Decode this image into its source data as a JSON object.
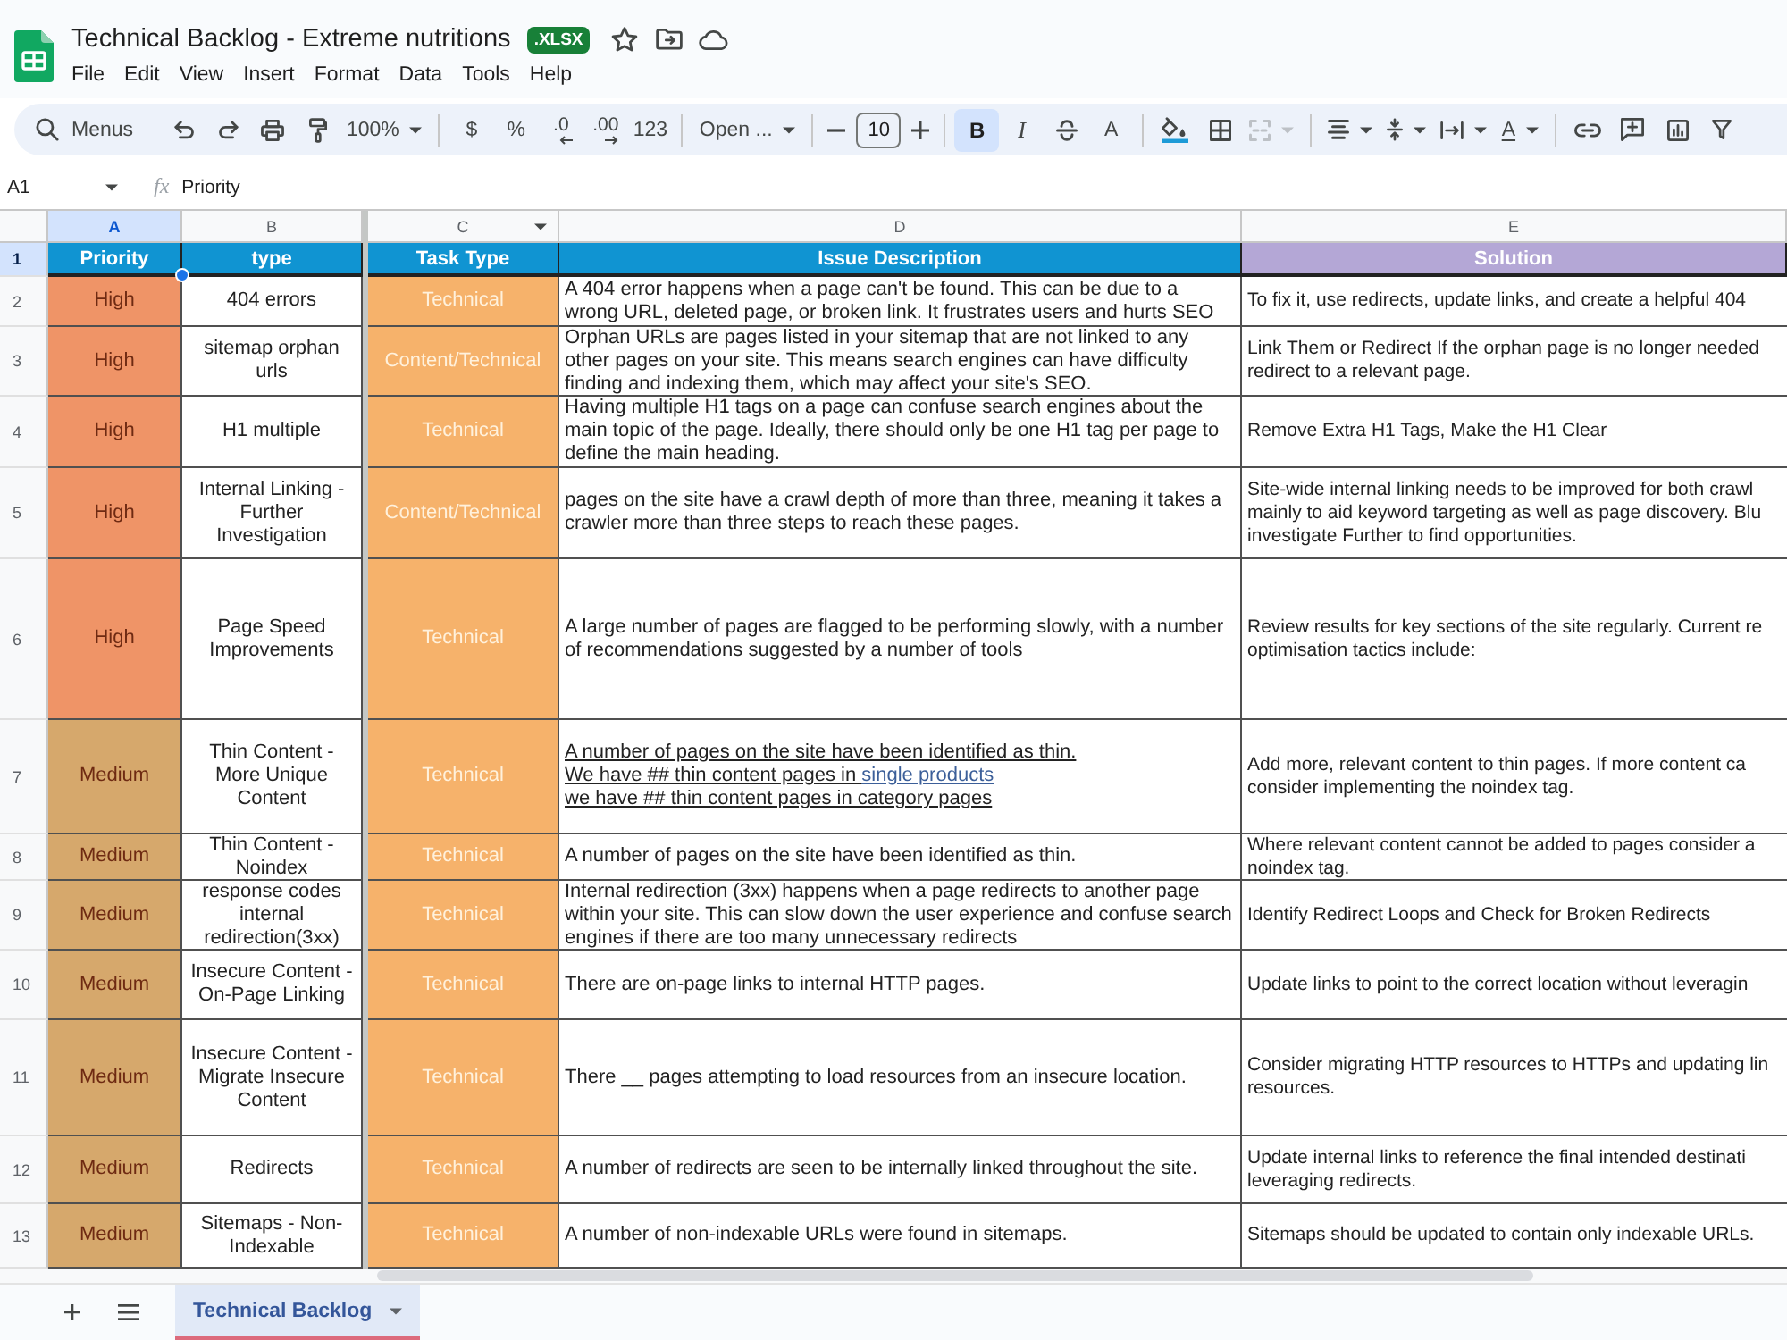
{
  "window": {
    "title": "Technical Backlog - Extreme nutritions",
    "badge": ".XLSX"
  },
  "menu": [
    "File",
    "Edit",
    "View",
    "Insert",
    "Format",
    "Data",
    "Tools",
    "Help"
  ],
  "toolbar": {
    "search": {
      "placeholder": "Menus"
    },
    "zoom": "100%",
    "currency": "$",
    "percent": "%",
    "decrease_decimals": ".0",
    "increase_decimals": ".00",
    "number_format": "123",
    "font": "Open ...",
    "font_size": "10",
    "style_buttons": [
      {
        "label": "B",
        "on": true
      },
      {
        "label": "I",
        "on": false
      }
    ],
    "text_color": "A",
    "merge": {
      "disabled": true
    },
    "text_rotation": "A"
  },
  "formula_bar": {
    "cell": "A1",
    "function_label": "fx",
    "value": "Priority"
  },
  "columns": [
    {
      "label": "A",
      "selected": true,
      "filter": false
    },
    {
      "label": "B",
      "selected": false,
      "filter": false
    },
    {
      "label": "C",
      "selected": false,
      "filter": true
    },
    {
      "label": "D",
      "selected": false,
      "filter": false
    },
    {
      "label": "E",
      "selected": false,
      "filter": false
    }
  ],
  "header_row": {
    "number": "1",
    "selected": true,
    "cells": [
      {
        "text": "Priority",
        "color": "#1094d2"
      },
      {
        "text": "type",
        "color": "#1094d2"
      },
      {
        "text": "Task Type",
        "color": "#1094d2"
      },
      {
        "text": "Issue Description",
        "color": "#1094d2"
      },
      {
        "text": "Solution",
        "color": "#b4a7d6"
      }
    ]
  },
  "rows": [
    {
      "number": "2",
      "selected": false,
      "priority": {
        "text": "High",
        "color": "#ef9467"
      },
      "type": "404 errors",
      "task_type": "Technical",
      "description": "A 404 error happens when a page can't be found. This can be due to a wrong URL, deleted page, or broken link. It frustrates users and hurts SEO",
      "underlined": false,
      "solution": "To fix it, use redirects, update links, and create a helpful 404"
    },
    {
      "number": "3",
      "selected": false,
      "priority": {
        "text": "High",
        "color": "#ef9467"
      },
      "type": "sitemap orphan urls",
      "task_type": "Content/Technical",
      "description": "Orphan URLs are pages listed in your sitemap that are not linked to any other pages on your site. This means search engines can have difficulty finding and indexing them, which may affect your site's SEO.",
      "underlined": false,
      "solution": "Link Them or Redirect If the orphan page is no longer needed\nredirect to a relevant page."
    },
    {
      "number": "4",
      "selected": false,
      "priority": {
        "text": "High",
        "color": "#ef9467"
      },
      "type": "H1 multiple",
      "task_type": "Technical",
      "description": "Having multiple H1 tags on a page can confuse search engines about the main topic of the page. Ideally, there should only be one H1 tag per page to define the main heading.",
      "underlined": false,
      "solution": "Remove Extra H1 Tags, Make the H1 Clear"
    },
    {
      "number": "5",
      "selected": false,
      "priority": {
        "text": "High",
        "color": "#ef9467"
      },
      "type": "Internal Linking - Further Investigation",
      "task_type": "Content/Technical",
      "description": "pages on the site have a crawl depth of more than three, meaning it takes a crawler more than three steps to reach these pages.",
      "underlined": false,
      "solution": "Site-wide internal linking needs to be improved for both crawl\nmainly to aid keyword targeting as well as page discovery. Blu\ninvestigate Further to find opportunities."
    },
    {
      "number": "6",
      "selected": false,
      "priority": {
        "text": "High",
        "color": "#ef9467"
      },
      "type": "Page Speed Improvements",
      "task_type": "Technical",
      "description": "A large number of pages are flagged to be performing slowly, with a number of recommendations suggested by a number of tools",
      "underlined": false,
      "solution": "Review results for key sections of the site regularly. Current re\noptimisation tactics include:"
    },
    {
      "number": "7",
      "selected": false,
      "priority": {
        "text": "Medium",
        "color": "#d6a86c"
      },
      "type": "Thin Content - More Unique Content",
      "task_type": "Technical",
      "description": [
        {
          "kind": "text",
          "text": "A number of pages on the site have been identified as thin.\nWe have ## thin content pages in "
        },
        {
          "kind": "link",
          "text": "single products"
        },
        {
          "kind": "text",
          "text": "\nwe have ## thin content pages in category pages"
        }
      ],
      "underlined": true,
      "solution": "Add more, relevant content to thin pages. If more content ca\nconsider implementing the noindex tag."
    },
    {
      "number": "8",
      "selected": false,
      "priority": {
        "text": "Medium",
        "color": "#d6a86c"
      },
      "type": "Thin Content - Noindex",
      "task_type": "Technical",
      "description": "A number of pages on the site have been identified as thin.",
      "underlined": false,
      "solution": "Where relevant content cannot be added to pages consider a\nnoindex tag."
    },
    {
      "number": "9",
      "selected": false,
      "priority": {
        "text": "Medium",
        "color": "#d6a86c"
      },
      "type": "response codes internal redirection(3xx)",
      "task_type": "Technical",
      "description": "Internal redirection (3xx) happens when a page redirects to another page within your site. This can slow down the user experience and confuse search engines if there are too many unnecessary redirects",
      "underlined": false,
      "solution": "Identify Redirect Loops and Check for Broken Redirects"
    },
    {
      "number": "10",
      "selected": false,
      "priority": {
        "text": "Medium",
        "color": "#d6a86c"
      },
      "type": "Insecure Content - On-Page Linking",
      "task_type": "Technical",
      "description": "There are on-page links to internal HTTP pages.",
      "underlined": false,
      "solution": "Update links to point to the correct location without leveragin"
    },
    {
      "number": "11",
      "selected": false,
      "priority": {
        "text": "Medium",
        "color": "#d6a86c"
      },
      "type": "Insecure Content - Migrate Insecure Content",
      "task_type": "Technical",
      "description": "There __ pages attempting to load resources from an insecure location.",
      "underlined": false,
      "solution": "Consider migrating HTTP resources to HTTPs and updating lin\nresources."
    },
    {
      "number": "12",
      "selected": false,
      "priority": {
        "text": "Medium",
        "color": "#d6a86c"
      },
      "type": "Redirects",
      "task_type": "Technical",
      "description": "A number of redirects are seen to be internally linked throughout the site.",
      "underlined": false,
      "solution": "Update internal links to reference the final intended destinati\nleveraging redirects."
    },
    {
      "number": "13",
      "selected": false,
      "priority": {
        "text": "Medium",
        "color": "#d6a86c"
      },
      "type": "Sitemaps - Non-Indexable",
      "task_type": "Technical",
      "description": "A number of non-indexable URLs were found in sitemaps.",
      "underlined": false,
      "solution": "Sitemaps should be updated to contain only indexable URLs."
    }
  ],
  "sheet_tabs": [
    {
      "label": "Technical Backlog",
      "selected": true
    }
  ]
}
